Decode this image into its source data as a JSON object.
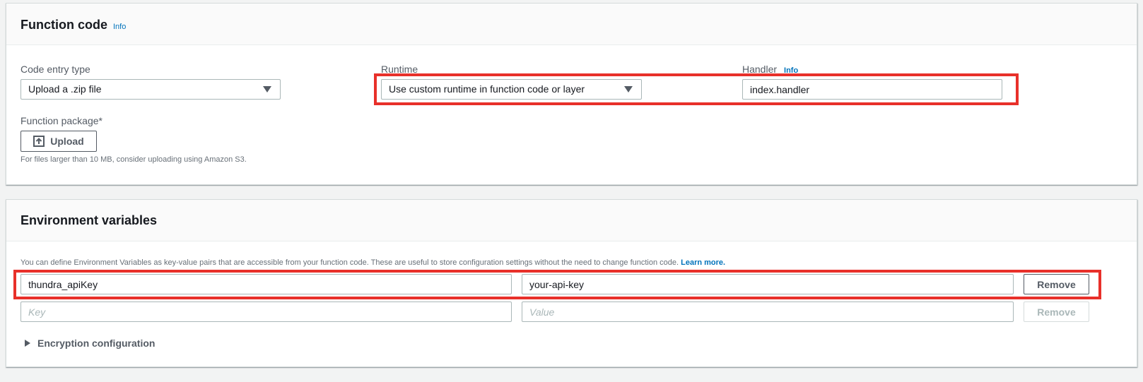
{
  "function_code": {
    "title": "Function code",
    "info": "Info",
    "code_entry_type": {
      "label": "Code entry type",
      "value": "Upload a .zip file"
    },
    "runtime": {
      "label": "Runtime",
      "value": "Use custom runtime in function code or layer"
    },
    "handler": {
      "label": "Handler",
      "info": "Info",
      "value": "index.handler"
    },
    "function_package": {
      "label": "Function package*",
      "upload_label": "Upload",
      "hint": "For files larger than 10 MB, consider uploading using Amazon S3."
    }
  },
  "environment_variables": {
    "title": "Environment variables",
    "description": "You can define Environment Variables as key-value pairs that are accessible from your function code. These are useful to store configuration settings without the need to change function code.",
    "learn_more": "Learn more.",
    "rows": [
      {
        "key": "thundra_apiKey",
        "value": "your-api-key",
        "remove_label": "Remove"
      },
      {
        "key": "",
        "value": "",
        "remove_label": "Remove"
      }
    ],
    "key_placeholder": "Key",
    "value_placeholder": "Value",
    "encryption": "Encryption configuration"
  },
  "icons": {
    "upload": "upload-icon",
    "dropdown": "caret-down-icon",
    "expand": "caret-right-icon"
  },
  "colors": {
    "highlight": "#e8302a",
    "link": "#0073bb",
    "background": "#f2f3f3"
  }
}
